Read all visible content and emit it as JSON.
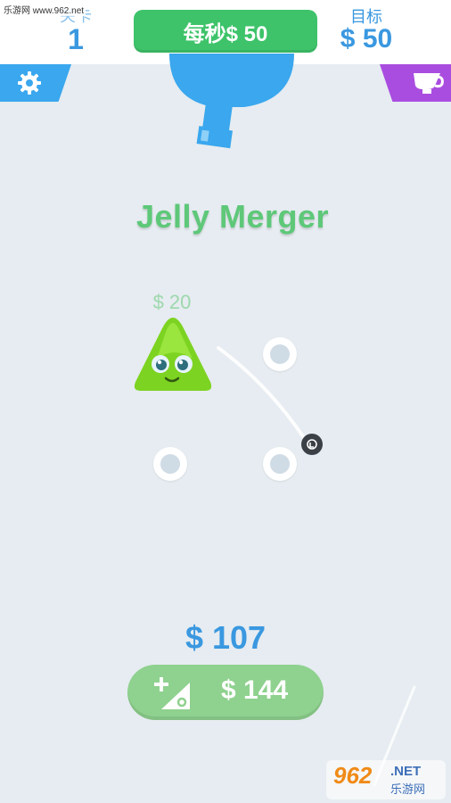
{
  "header": {
    "watermark": "乐游网 www.962.net",
    "level_label": "关卡",
    "level_value": "1",
    "rate_text": "每秒$ 50",
    "target_label": "目标",
    "target_value": "$ 50"
  },
  "buttons": {
    "settings_icon": "gear-icon",
    "shop_icon": "trophy-cup-icon"
  },
  "title": "Jelly Merger",
  "board": {
    "jelly_price": "$ 20",
    "jelly_color": "#7dd321",
    "slot_count": 4
  },
  "footer": {
    "money": "$ 107",
    "buy_price": "$ 144",
    "buy_icon": "add-jelly-icon"
  },
  "logo": {
    "brand": "962",
    "suffix": ".NET",
    "cn": "乐游网"
  },
  "colors": {
    "accent_blue": "#3a98e0",
    "accent_green": "#3ec36a",
    "shop_purple": "#a94de0",
    "buy_green": "#8fd18f"
  }
}
